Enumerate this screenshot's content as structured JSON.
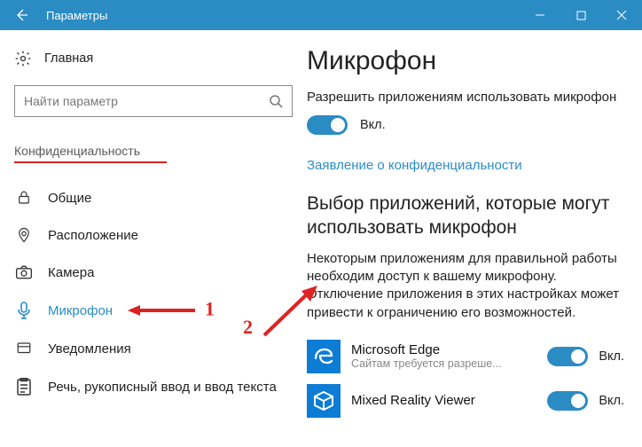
{
  "titlebar": {
    "title": "Параметры"
  },
  "sidebar": {
    "home": "Главная",
    "search_placeholder": "Найти параметр",
    "section_header": "Конфиденциальность",
    "items": [
      {
        "label": "Общие"
      },
      {
        "label": "Расположение"
      },
      {
        "label": "Камера"
      },
      {
        "label": "Микрофон"
      },
      {
        "label": "Уведомления"
      },
      {
        "label": "Речь, рукописный ввод и ввод текста"
      }
    ]
  },
  "annotations": {
    "one": "1",
    "two": "2"
  },
  "main": {
    "heading": "Микрофон",
    "allow_desc": "Разрешить приложениям использовать микрофон",
    "toggle_on": "Вкл.",
    "privacy_link": "Заявление о конфиденциальности",
    "choose_heading": "Выбор приложений, которые могут использовать микрофон",
    "choose_info": "Некоторым приложениям для правильной работы необходим доступ к вашему микрофону. Отключение приложения в этих настройках может привести к ограничению его возможностей.",
    "apps": [
      {
        "name": "Microsoft Edge",
        "sub": "Сайтам требуется разреше...",
        "state": "Вкл."
      },
      {
        "name": "Mixed Reality Viewer",
        "sub": "",
        "state": "Вкл."
      }
    ]
  }
}
